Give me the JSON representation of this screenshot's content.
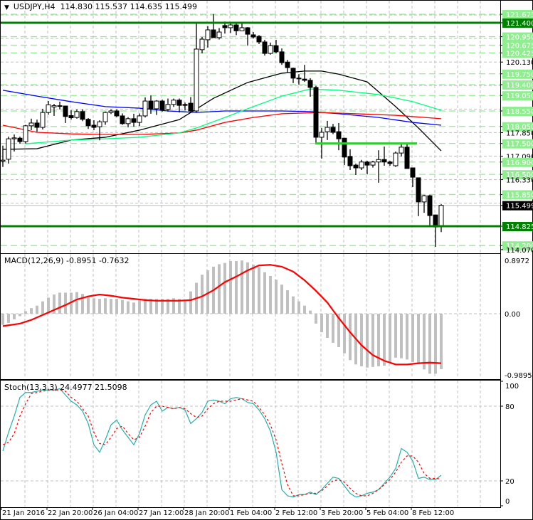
{
  "header": {
    "symbol": "USDJPY,H4",
    "open": "114.830",
    "high": "115.537",
    "low": "114.635",
    "close": "115.499"
  },
  "colors": {
    "bull": "#ffffff",
    "bear": "#000000",
    "hline_major": "#008000",
    "hline_minor": "#90ee90",
    "hline_short": "#32cd32",
    "grid": "#c0c0c0",
    "ma_black": "#000000",
    "ma_blue": "#0000ff",
    "ma_red": "#ff0000",
    "ma_green": "#00ff7f",
    "macd_hist": "#c0c0c0",
    "macd_signal": "#ff0000",
    "stoch_main": "#20b2aa",
    "stoch_signal": "#ff0000"
  },
  "price_axis": {
    "labels": [
      {
        "text": "121.675",
        "price": 121.675,
        "style": "green"
      },
      {
        "text": "121.400",
        "price": 121.4,
        "style": "darkgreen"
      },
      {
        "text": "120.950",
        "price": 120.95,
        "style": "green"
      },
      {
        "text": "120.675",
        "price": 120.675,
        "style": "green"
      },
      {
        "text": "120.425",
        "price": 120.425,
        "style": "green"
      },
      {
        "text": "120.130",
        "price": 120.13,
        "style": "plain"
      },
      {
        "text": "119.750",
        "price": 119.75,
        "style": "green"
      },
      {
        "text": "119.400",
        "price": 119.4,
        "style": "green"
      },
      {
        "text": "119.050",
        "price": 119.05,
        "style": "green"
      },
      {
        "text": "118.550",
        "price": 118.55,
        "style": "green"
      },
      {
        "text": "118.050",
        "price": 118.05,
        "style": "green"
      },
      {
        "text": "117.850",
        "price": 117.85,
        "style": "plain"
      },
      {
        "text": "117.500",
        "price": 117.5,
        "style": "green"
      },
      {
        "text": "117.090",
        "price": 117.09,
        "style": "plain"
      },
      {
        "text": "116.900",
        "price": 116.9,
        "style": "green"
      },
      {
        "text": "116.500",
        "price": 116.5,
        "style": "green"
      },
      {
        "text": "116.330",
        "price": 116.33,
        "style": "plain"
      },
      {
        "text": "115.850",
        "price": 115.85,
        "style": "green"
      },
      {
        "text": "115.499",
        "price": 115.499,
        "style": "current"
      },
      {
        "text": "114.825",
        "price": 114.825,
        "style": "darkgreen"
      },
      {
        "text": "114.200",
        "price": 114.2,
        "style": "green"
      },
      {
        "text": "114.070",
        "price": 114.07,
        "style": "plain"
      }
    ],
    "grid_prices": [
      121.65,
      120.89,
      120.13,
      119.37,
      118.61,
      117.85,
      117.09,
      116.33,
      115.57,
      114.81
    ]
  },
  "levels": {
    "major": [
      121.4,
      114.825
    ],
    "minor": [
      121.675,
      120.95,
      120.675,
      120.425,
      119.75,
      119.4,
      119.05,
      118.55,
      118.05,
      117.5,
      116.9,
      116.5,
      115.85,
      114.2
    ],
    "short": {
      "price": 117.5,
      "from_index": 55,
      "to_index": 72
    }
  },
  "time_axis": [
    {
      "text": "21 Jan 2016",
      "index": 0
    },
    {
      "text": "22 Jan 20:00",
      "index": 8
    },
    {
      "text": "26 Jan 04:00",
      "index": 16
    },
    {
      "text": "27 Jan 12:00",
      "index": 24
    },
    {
      "text": "28 Jan 20:00",
      "index": 32
    },
    {
      "text": "1 Feb 04:00",
      "index": 40
    },
    {
      "text": "2 Feb 12:00",
      "index": 48
    },
    {
      "text": "3 Feb 20:00",
      "index": 56
    },
    {
      "text": "5 Feb 04:00",
      "index": 64
    },
    {
      "text": "8 Feb 12:00",
      "index": 72
    }
  ],
  "chart_data": {
    "type": "candlestick",
    "timeframe": "H4",
    "candles": [
      [
        116.93,
        117.43,
        116.74,
        116.96
      ],
      [
        116.99,
        117.72,
        116.85,
        117.65
      ],
      [
        117.65,
        117.79,
        117.24,
        117.68
      ],
      [
        117.67,
        117.72,
        117.49,
        117.56
      ],
      [
        117.56,
        118.1,
        117.5,
        118.07
      ],
      [
        118.07,
        118.3,
        117.93,
        118.16
      ],
      [
        118.16,
        118.27,
        117.88,
        118.02
      ],
      [
        118.02,
        118.62,
        117.95,
        118.5
      ],
      [
        118.5,
        118.87,
        118.43,
        118.75
      ],
      [
        118.68,
        118.78,
        118.39,
        118.72
      ],
      [
        118.71,
        118.85,
        118.6,
        118.72
      ],
      [
        118.71,
        118.72,
        118.16,
        118.37
      ],
      [
        118.4,
        118.57,
        118.27,
        118.33
      ],
      [
        118.34,
        118.6,
        118.3,
        118.53
      ],
      [
        118.53,
        118.6,
        118.22,
        118.28
      ],
      [
        118.28,
        118.32,
        117.97,
        118.07
      ],
      [
        118.09,
        118.25,
        117.93,
        118.02
      ],
      [
        118.04,
        118.25,
        117.6,
        118.2
      ],
      [
        118.2,
        118.53,
        118.1,
        118.5
      ],
      [
        118.5,
        118.6,
        118.45,
        118.55
      ],
      [
        118.55,
        118.6,
        118.35,
        118.39
      ],
      [
        118.39,
        118.47,
        118.1,
        118.14
      ],
      [
        118.14,
        118.35,
        118.02,
        118.3
      ],
      [
        118.3,
        118.46,
        118.04,
        118.18
      ],
      [
        118.18,
        118.47,
        118.06,
        118.39
      ],
      [
        118.39,
        118.99,
        118.34,
        118.87
      ],
      [
        118.87,
        119.05,
        118.46,
        118.62
      ],
      [
        118.62,
        118.9,
        118.42,
        118.87
      ],
      [
        118.87,
        118.92,
        118.53,
        118.58
      ],
      [
        118.6,
        118.95,
        118.53,
        118.76
      ],
      [
        118.76,
        118.95,
        118.68,
        118.9
      ],
      [
        118.9,
        118.95,
        118.5,
        118.73
      ],
      [
        118.76,
        118.82,
        118.57,
        118.73
      ],
      [
        118.8,
        119.0,
        118.48,
        118.55
      ],
      [
        118.55,
        121.4,
        118.5,
        120.55
      ],
      [
        120.53,
        120.94,
        120.41,
        120.87
      ],
      [
        120.85,
        121.29,
        120.6,
        121.17
      ],
      [
        121.17,
        121.68,
        120.92,
        120.92
      ],
      [
        120.92,
        121.23,
        120.86,
        121.1
      ],
      [
        121.31,
        121.44,
        121.05,
        121.24
      ],
      [
        121.24,
        121.37,
        121.07,
        121.33
      ],
      [
        121.33,
        121.37,
        121.0,
        121.14
      ],
      [
        121.14,
        121.39,
        121.14,
        121.24
      ],
      [
        121.24,
        121.26,
        120.66,
        121.03
      ],
      [
        121.01,
        121.1,
        120.89,
        120.94
      ],
      [
        120.96,
        121.0,
        120.71,
        120.78
      ],
      [
        120.78,
        120.85,
        120.34,
        120.41
      ],
      [
        120.41,
        120.76,
        120.37,
        120.66
      ],
      [
        120.66,
        120.85,
        120.41,
        120.46
      ],
      [
        120.46,
        120.57,
        120.04,
        120.11
      ],
      [
        120.13,
        120.2,
        119.79,
        119.95
      ],
      [
        119.93,
        119.95,
        119.45,
        119.61
      ],
      [
        119.61,
        119.74,
        119.4,
        119.6
      ],
      [
        119.58,
        120.04,
        119.49,
        119.54
      ],
      [
        119.54,
        119.61,
        119.01,
        119.31
      ],
      [
        119.31,
        119.36,
        117.47,
        117.7
      ],
      [
        117.7,
        118.0,
        117.01,
        117.86
      ],
      [
        117.88,
        118.23,
        117.61,
        118.02
      ],
      [
        118.02,
        118.13,
        117.8,
        117.86
      ],
      [
        117.88,
        118.16,
        117.28,
        117.65
      ],
      [
        117.67,
        117.68,
        116.8,
        117.06
      ],
      [
        117.08,
        117.31,
        116.64,
        116.78
      ],
      [
        116.8,
        116.85,
        116.48,
        116.71
      ],
      [
        116.71,
        116.97,
        116.64,
        116.9
      ],
      [
        116.9,
        116.94,
        116.5,
        116.8
      ],
      [
        116.8,
        116.94,
        116.72,
        116.9
      ],
      [
        116.9,
        117.28,
        116.23,
        116.98
      ],
      [
        116.98,
        117.4,
        116.78,
        116.9
      ],
      [
        116.9,
        116.94,
        116.78,
        116.85
      ],
      [
        116.78,
        117.24,
        116.74,
        117.19
      ],
      [
        117.19,
        117.47,
        117.08,
        117.38
      ],
      [
        117.38,
        117.52,
        116.69,
        116.69
      ],
      [
        116.71,
        116.71,
        116.09,
        116.41
      ],
      [
        116.39,
        116.39,
        115.15,
        115.61
      ],
      [
        115.61,
        115.84,
        115.26,
        115.81
      ],
      [
        115.81,
        115.84,
        114.83,
        115.17
      ],
      [
        115.19,
        115.2,
        114.16,
        114.8
      ],
      [
        114.83,
        115.537,
        114.635,
        115.499
      ]
    ],
    "moving_averages": [
      {
        "name": "ma-black",
        "color": "#000000",
        "points": [
          [
            0,
            117.31
          ],
          [
            6,
            117.33
          ],
          [
            12,
            117.61
          ],
          [
            18,
            117.7
          ],
          [
            24,
            117.93
          ],
          [
            31,
            118.27
          ],
          [
            33,
            118.5
          ],
          [
            37,
            118.96
          ],
          [
            43,
            119.47
          ],
          [
            49,
            119.77
          ],
          [
            53,
            119.84
          ],
          [
            56,
            119.84
          ],
          [
            59,
            119.74
          ],
          [
            64,
            119.49
          ],
          [
            69,
            118.69
          ],
          [
            73,
            118.0
          ],
          [
            77,
            117.26
          ]
        ]
      },
      {
        "name": "ma-blue",
        "color": "#0000ff",
        "points": [
          [
            0,
            119.22
          ],
          [
            6,
            119.03
          ],
          [
            12,
            118.85
          ],
          [
            18,
            118.69
          ],
          [
            24,
            118.64
          ],
          [
            29,
            118.55
          ],
          [
            34,
            118.5
          ],
          [
            39,
            118.55
          ],
          [
            49,
            118.55
          ],
          [
            54,
            118.53
          ],
          [
            59,
            118.46
          ],
          [
            66,
            118.34
          ],
          [
            72,
            118.18
          ],
          [
            77,
            118.09
          ]
        ]
      },
      {
        "name": "ma-red",
        "color": "#ff0000",
        "points": [
          [
            0,
            118.09
          ],
          [
            6,
            117.86
          ],
          [
            12,
            117.81
          ],
          [
            18,
            117.79
          ],
          [
            24,
            117.79
          ],
          [
            31,
            117.84
          ],
          [
            34,
            117.93
          ],
          [
            39,
            118.18
          ],
          [
            44,
            118.34
          ],
          [
            49,
            118.46
          ],
          [
            56,
            118.5
          ],
          [
            62,
            118.46
          ],
          [
            69,
            118.41
          ],
          [
            77,
            118.3
          ]
        ]
      },
      {
        "name": "ma-green",
        "color": "#00ff7f",
        "points": [
          [
            4,
            117.49
          ],
          [
            12,
            117.61
          ],
          [
            18,
            117.65
          ],
          [
            24,
            117.7
          ],
          [
            31,
            117.84
          ],
          [
            34,
            118.0
          ],
          [
            39,
            118.34
          ],
          [
            44,
            118.69
          ],
          [
            49,
            119.03
          ],
          [
            54,
            119.26
          ],
          [
            59,
            119.22
          ],
          [
            66,
            119.08
          ],
          [
            72,
            118.85
          ],
          [
            77,
            118.57
          ]
        ]
      }
    ],
    "macd": {
      "title": "MACD(12,26,9) -0.8951 -0.7632",
      "axis_labels": [
        {
          "text": "0.8972",
          "value": 0.8972
        },
        {
          "text": "0.00",
          "value": 0
        },
        {
          "text": "-0.9895",
          "value": -0.9895
        }
      ],
      "histogram": [
        -0.18,
        -0.15,
        -0.09,
        -0.04,
        0.04,
        0.09,
        0.13,
        0.2,
        0.26,
        0.31,
        0.34,
        0.34,
        0.34,
        0.35,
        0.32,
        0.29,
        0.25,
        0.24,
        0.25,
        0.24,
        0.24,
        0.22,
        0.2,
        0.18,
        0.22,
        0.24,
        0.24,
        0.24,
        0.24,
        0.24,
        0.25,
        0.24,
        0.22,
        0.36,
        0.5,
        0.63,
        0.7,
        0.76,
        0.8,
        0.82,
        0.85,
        0.85,
        0.86,
        0.83,
        0.79,
        0.75,
        0.67,
        0.61,
        0.55,
        0.47,
        0.38,
        0.28,
        0.2,
        0.13,
        0.05,
        -0.16,
        -0.3,
        -0.39,
        -0.47,
        -0.54,
        -0.64,
        -0.75,
        -0.82,
        -0.85,
        -0.87,
        -0.86,
        -0.85,
        -0.84,
        -0.78,
        -0.71,
        -0.72,
        -0.74,
        -0.78,
        -0.82,
        -0.9,
        -0.97,
        -0.97,
        -0.8951
      ],
      "signal": [
        [
          0,
          -0.2
        ],
        [
          3,
          -0.16
        ],
        [
          5,
          -0.1
        ],
        [
          7,
          -0.02
        ],
        [
          9,
          0.06
        ],
        [
          11,
          0.14
        ],
        [
          13,
          0.23
        ],
        [
          15,
          0.28
        ],
        [
          17,
          0.31
        ],
        [
          19,
          0.29
        ],
        [
          21,
          0.26
        ],
        [
          23,
          0.24
        ],
        [
          25,
          0.22
        ],
        [
          27,
          0.21
        ],
        [
          31,
          0.21
        ],
        [
          33,
          0.22
        ],
        [
          35,
          0.28
        ],
        [
          37,
          0.38
        ],
        [
          39,
          0.51
        ],
        [
          41,
          0.6
        ],
        [
          43,
          0.7
        ],
        [
          45,
          0.78
        ],
        [
          47,
          0.79
        ],
        [
          49,
          0.76
        ],
        [
          51,
          0.68
        ],
        [
          53,
          0.54
        ],
        [
          55,
          0.37
        ],
        [
          57,
          0.18
        ],
        [
          59,
          -0.07
        ],
        [
          61,
          -0.3
        ],
        [
          63,
          -0.51
        ],
        [
          65,
          -0.67
        ],
        [
          67,
          -0.76
        ],
        [
          69,
          -0.82
        ],
        [
          71,
          -0.82
        ],
        [
          73,
          -0.8
        ],
        [
          75,
          -0.79
        ],
        [
          77,
          -0.8
        ]
      ],
      "ylim": [
        -0.9895,
        0.8972
      ]
    },
    "stochastic": {
      "title": "Stoch(13,3,3) 24.4977 21.5098",
      "axis_labels": [
        {
          "text": "100",
          "value": 100
        },
        {
          "text": "80",
          "value": 80
        },
        {
          "text": "20",
          "value": 20
        },
        {
          "text": "0",
          "value": 0
        }
      ],
      "main": [
        44,
        59,
        72,
        87,
        91,
        91,
        92,
        93,
        93,
        93,
        94,
        89,
        84,
        81,
        76,
        66,
        49,
        43,
        53,
        65,
        69,
        61,
        55,
        49,
        58,
        73,
        81,
        84,
        76,
        79,
        78,
        79,
        77,
        66,
        70,
        75,
        84,
        85,
        84,
        82,
        86,
        87,
        86,
        83,
        82,
        77,
        70,
        60,
        43,
        13,
        8,
        7,
        9,
        9,
        11,
        9,
        13,
        18,
        23,
        22,
        16,
        10,
        7,
        8,
        10,
        11,
        13,
        18,
        23,
        30,
        46,
        43,
        36,
        22,
        23,
        21,
        21,
        24.4977
      ],
      "signal": [
        49,
        51,
        58,
        72,
        82,
        90,
        91,
        92,
        93,
        93,
        93,
        92,
        87,
        84,
        78,
        72,
        59,
        50,
        49,
        55,
        62,
        64,
        58,
        53,
        55,
        64,
        75,
        80,
        80,
        79,
        78,
        79,
        78,
        74,
        71,
        72,
        78,
        82,
        84,
        84,
        84,
        85,
        86,
        85,
        84,
        79,
        73,
        65,
        53,
        34,
        17,
        8,
        8,
        9,
        10,
        10,
        12,
        16,
        20,
        21,
        19,
        14,
        10,
        8,
        8,
        10,
        13,
        17,
        21,
        27,
        35,
        40,
        40,
        35,
        26,
        22,
        22,
        21.5098
      ],
      "ylim": [
        0,
        100
      ]
    }
  }
}
